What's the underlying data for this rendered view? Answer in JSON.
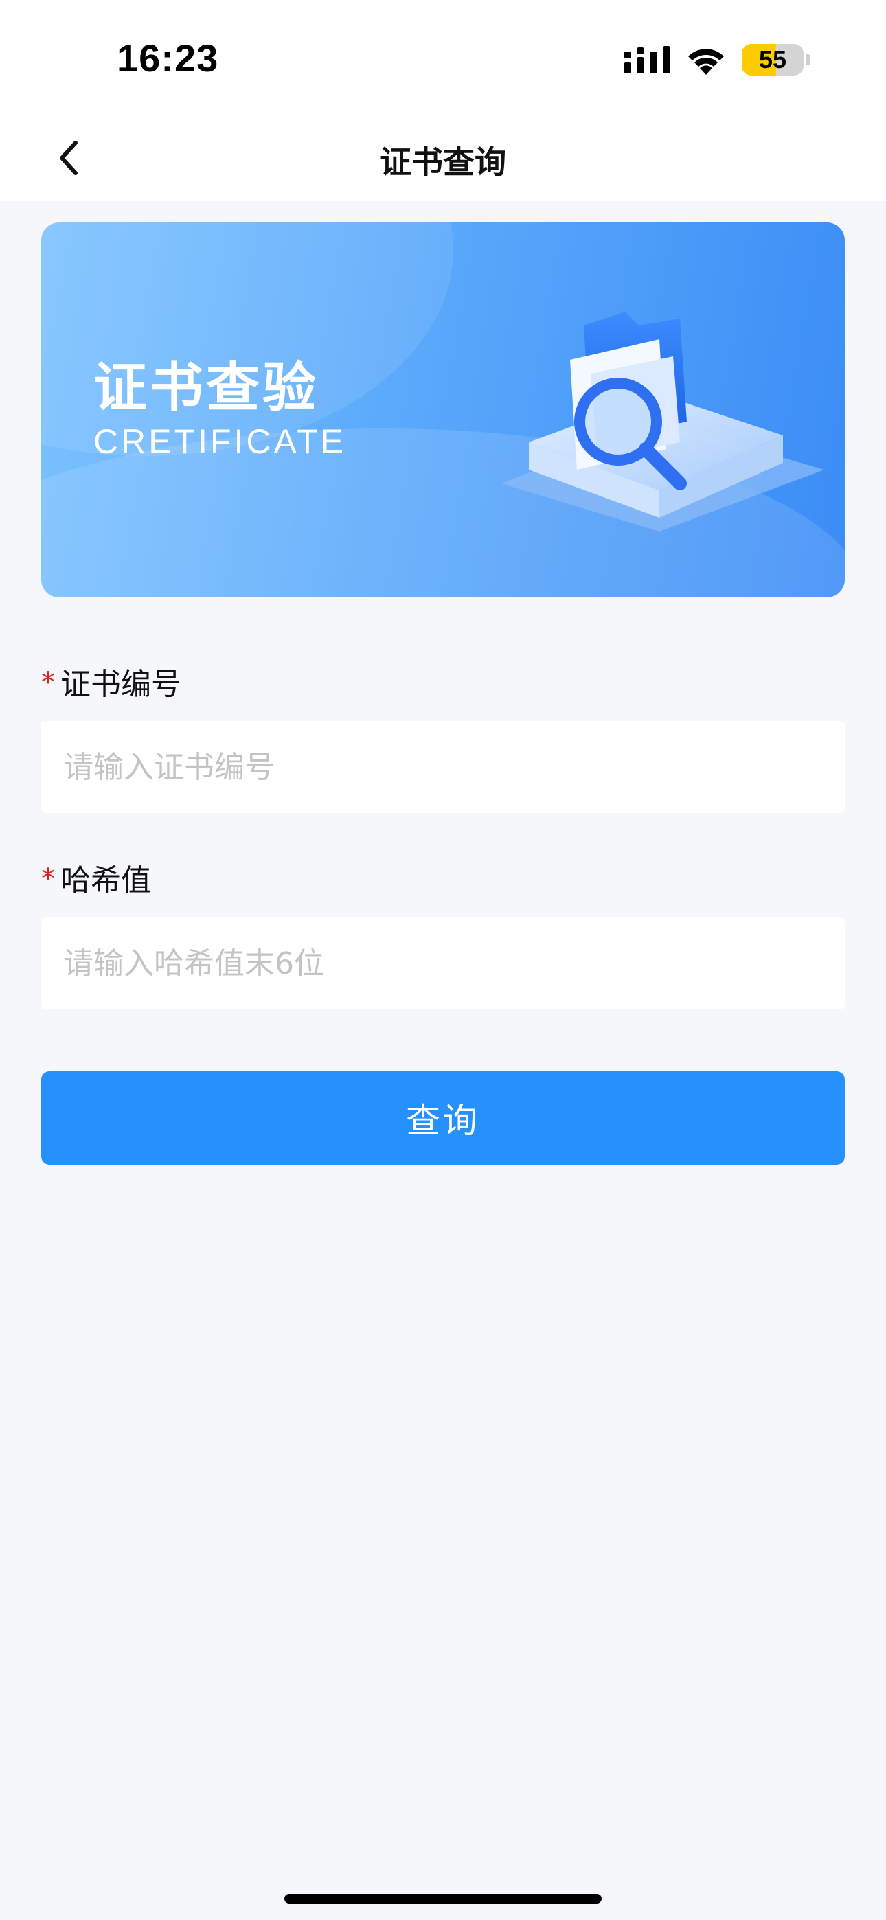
{
  "status_bar": {
    "time": "16:23",
    "battery_level": "55",
    "icons": [
      "signal-icon",
      "wifi-icon",
      "battery-icon"
    ]
  },
  "nav": {
    "title": "证书查询",
    "back_icon": "chevron-left-icon"
  },
  "banner": {
    "title": "证书查验",
    "subtitle": "CRETIFICATE",
    "illustration": "folder-magnifier-illustration"
  },
  "form": {
    "cert_number": {
      "required_mark": "*",
      "label": "证书编号",
      "placeholder": "请输入证书编号",
      "value": ""
    },
    "hash": {
      "required_mark": "*",
      "label": "哈希值",
      "placeholder": "请输入哈希值末6位",
      "value": ""
    },
    "submit_label": "查询"
  },
  "colors": {
    "primary": "#2690fc",
    "required": "#e02020",
    "background": "#f5f7fa",
    "battery": "#ffcc00"
  }
}
